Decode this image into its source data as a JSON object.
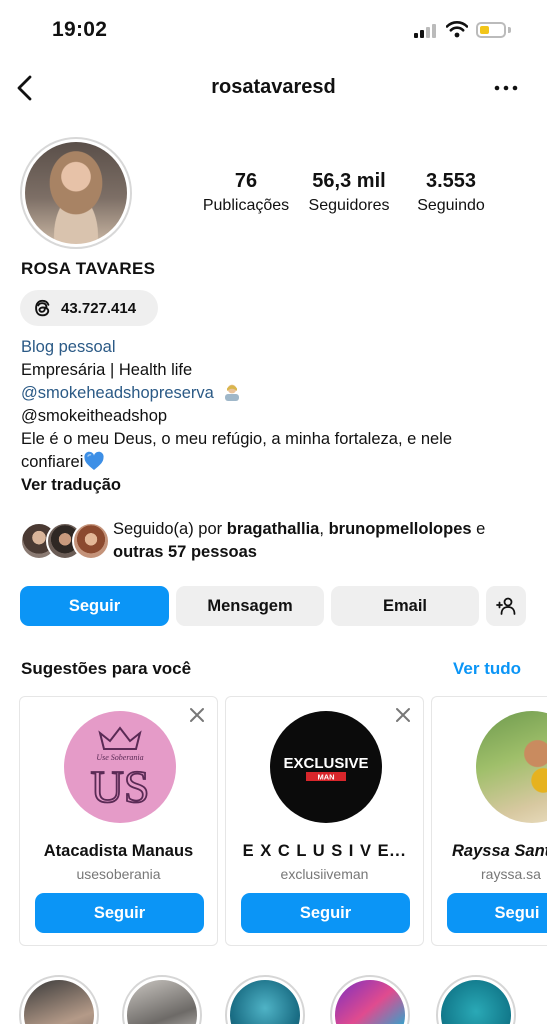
{
  "status_bar": {
    "time": "19:02"
  },
  "nav": {
    "username": "rosatavaresd"
  },
  "profile": {
    "stats": [
      {
        "value": "76",
        "label": "Publicações"
      },
      {
        "value": "56,3 mil",
        "label": "Seguidores"
      },
      {
        "value": "3.553",
        "label": "Seguindo"
      }
    ],
    "name": "ROSA TAVARES",
    "threads_count": "43.727.414",
    "category": "Blog pessoal",
    "bio": {
      "line1": "Empresária | Health life",
      "mention1": "@smokeheadshopreserva",
      "line3": "@smokeitheadshop",
      "line4": "Ele é o meu Deus, o meu refúgio, a minha fortaleza, e nele",
      "line5": "confiarei",
      "translate": "Ver tradução"
    },
    "followed_by": {
      "prefix": "Seguido(a) por",
      "user1": "bragathallia",
      "sep": ",",
      "user2": "brunopmellolopes",
      "and": "e",
      "others": "outras 57 pessoas"
    }
  },
  "actions": {
    "follow": "Seguir",
    "message": "Mensagem",
    "email": "Email"
  },
  "suggestions": {
    "title": "Sugestões para você",
    "see_all": "Ver tudo",
    "cards": [
      {
        "name": "Atacadista Manaus",
        "handle": "usesoberania",
        "button": "Seguir",
        "logo_text": "Use Soberania",
        "logo_initials": "US"
      },
      {
        "name": "E X C L U S I V E...",
        "handle": "exclusiiveman",
        "button": "Seguir",
        "logo_text": "EXCLUSIVE",
        "logo_sub": "MAN"
      },
      {
        "name": "Rayssa Santo",
        "handle": "rayssa.sa",
        "button": "Segui"
      }
    ]
  },
  "colors": {
    "accent": "#0b95f6",
    "link": "#2b5a86",
    "secondary_button": "#efefef"
  }
}
